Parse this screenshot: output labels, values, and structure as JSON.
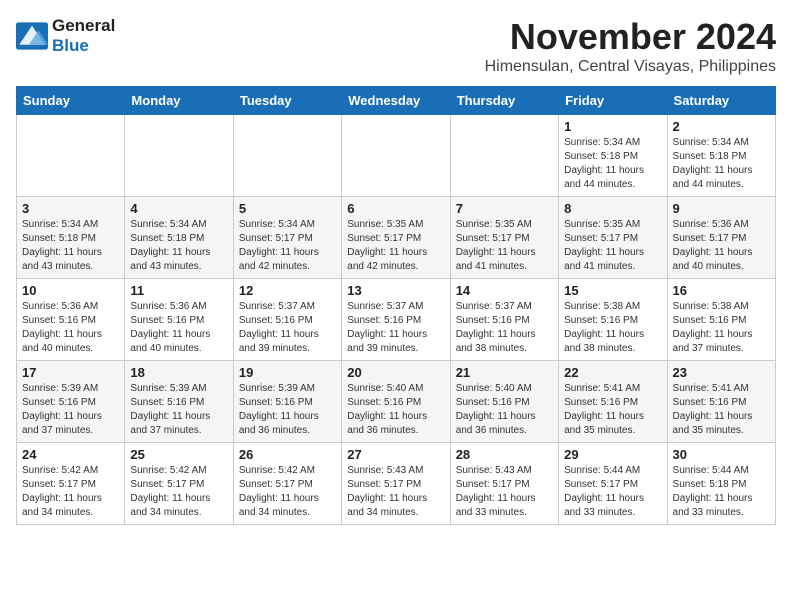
{
  "logo": {
    "line1": "General",
    "line2": "Blue"
  },
  "title": "November 2024",
  "location": "Himensulan, Central Visayas, Philippines",
  "weekdays": [
    "Sunday",
    "Monday",
    "Tuesday",
    "Wednesday",
    "Thursday",
    "Friday",
    "Saturday"
  ],
  "weeks": [
    [
      {
        "day": "",
        "info": ""
      },
      {
        "day": "",
        "info": ""
      },
      {
        "day": "",
        "info": ""
      },
      {
        "day": "",
        "info": ""
      },
      {
        "day": "",
        "info": ""
      },
      {
        "day": "1",
        "info": "Sunrise: 5:34 AM\nSunset: 5:18 PM\nDaylight: 11 hours and 44 minutes."
      },
      {
        "day": "2",
        "info": "Sunrise: 5:34 AM\nSunset: 5:18 PM\nDaylight: 11 hours and 44 minutes."
      }
    ],
    [
      {
        "day": "3",
        "info": "Sunrise: 5:34 AM\nSunset: 5:18 PM\nDaylight: 11 hours and 43 minutes."
      },
      {
        "day": "4",
        "info": "Sunrise: 5:34 AM\nSunset: 5:18 PM\nDaylight: 11 hours and 43 minutes."
      },
      {
        "day": "5",
        "info": "Sunrise: 5:34 AM\nSunset: 5:17 PM\nDaylight: 11 hours and 42 minutes."
      },
      {
        "day": "6",
        "info": "Sunrise: 5:35 AM\nSunset: 5:17 PM\nDaylight: 11 hours and 42 minutes."
      },
      {
        "day": "7",
        "info": "Sunrise: 5:35 AM\nSunset: 5:17 PM\nDaylight: 11 hours and 41 minutes."
      },
      {
        "day": "8",
        "info": "Sunrise: 5:35 AM\nSunset: 5:17 PM\nDaylight: 11 hours and 41 minutes."
      },
      {
        "day": "9",
        "info": "Sunrise: 5:36 AM\nSunset: 5:17 PM\nDaylight: 11 hours and 40 minutes."
      }
    ],
    [
      {
        "day": "10",
        "info": "Sunrise: 5:36 AM\nSunset: 5:16 PM\nDaylight: 11 hours and 40 minutes."
      },
      {
        "day": "11",
        "info": "Sunrise: 5:36 AM\nSunset: 5:16 PM\nDaylight: 11 hours and 40 minutes."
      },
      {
        "day": "12",
        "info": "Sunrise: 5:37 AM\nSunset: 5:16 PM\nDaylight: 11 hours and 39 minutes."
      },
      {
        "day": "13",
        "info": "Sunrise: 5:37 AM\nSunset: 5:16 PM\nDaylight: 11 hours and 39 minutes."
      },
      {
        "day": "14",
        "info": "Sunrise: 5:37 AM\nSunset: 5:16 PM\nDaylight: 11 hours and 38 minutes."
      },
      {
        "day": "15",
        "info": "Sunrise: 5:38 AM\nSunset: 5:16 PM\nDaylight: 11 hours and 38 minutes."
      },
      {
        "day": "16",
        "info": "Sunrise: 5:38 AM\nSunset: 5:16 PM\nDaylight: 11 hours and 37 minutes."
      }
    ],
    [
      {
        "day": "17",
        "info": "Sunrise: 5:39 AM\nSunset: 5:16 PM\nDaylight: 11 hours and 37 minutes."
      },
      {
        "day": "18",
        "info": "Sunrise: 5:39 AM\nSunset: 5:16 PM\nDaylight: 11 hours and 37 minutes."
      },
      {
        "day": "19",
        "info": "Sunrise: 5:39 AM\nSunset: 5:16 PM\nDaylight: 11 hours and 36 minutes."
      },
      {
        "day": "20",
        "info": "Sunrise: 5:40 AM\nSunset: 5:16 PM\nDaylight: 11 hours and 36 minutes."
      },
      {
        "day": "21",
        "info": "Sunrise: 5:40 AM\nSunset: 5:16 PM\nDaylight: 11 hours and 36 minutes."
      },
      {
        "day": "22",
        "info": "Sunrise: 5:41 AM\nSunset: 5:16 PM\nDaylight: 11 hours and 35 minutes."
      },
      {
        "day": "23",
        "info": "Sunrise: 5:41 AM\nSunset: 5:16 PM\nDaylight: 11 hours and 35 minutes."
      }
    ],
    [
      {
        "day": "24",
        "info": "Sunrise: 5:42 AM\nSunset: 5:17 PM\nDaylight: 11 hours and 34 minutes."
      },
      {
        "day": "25",
        "info": "Sunrise: 5:42 AM\nSunset: 5:17 PM\nDaylight: 11 hours and 34 minutes."
      },
      {
        "day": "26",
        "info": "Sunrise: 5:42 AM\nSunset: 5:17 PM\nDaylight: 11 hours and 34 minutes."
      },
      {
        "day": "27",
        "info": "Sunrise: 5:43 AM\nSunset: 5:17 PM\nDaylight: 11 hours and 34 minutes."
      },
      {
        "day": "28",
        "info": "Sunrise: 5:43 AM\nSunset: 5:17 PM\nDaylight: 11 hours and 33 minutes."
      },
      {
        "day": "29",
        "info": "Sunrise: 5:44 AM\nSunset: 5:17 PM\nDaylight: 11 hours and 33 minutes."
      },
      {
        "day": "30",
        "info": "Sunrise: 5:44 AM\nSunset: 5:18 PM\nDaylight: 11 hours and 33 minutes."
      }
    ]
  ]
}
